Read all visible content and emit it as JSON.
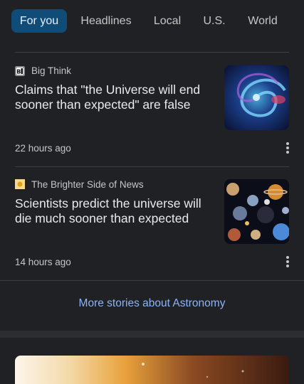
{
  "tabs": [
    {
      "label": "For you",
      "active": true
    },
    {
      "label": "Headlines",
      "active": false
    },
    {
      "label": "Local",
      "active": false
    },
    {
      "label": "U.S.",
      "active": false
    },
    {
      "label": "World",
      "active": false
    }
  ],
  "articles": [
    {
      "source": "Big Think",
      "source_icon": "big-think-logo",
      "headline": "Claims that \"the Universe will end sooner than expected\" are false",
      "time": "22 hours ago",
      "thumbnail": "spiral-galaxy-image"
    },
    {
      "source": "The Brighter Side of News",
      "source_icon": "brighter-side-logo",
      "headline": "Scientists predict the universe will die much sooner than expected",
      "time": "14 hours ago",
      "thumbnail": "planets-collage-image"
    }
  ],
  "more_stories": "More stories about Astronomy",
  "colors": {
    "background": "#202124",
    "tab_active_bg": "#104c78",
    "link": "#8ab4f8",
    "text_primary": "#e8eaed",
    "text_secondary": "#c4c7c5"
  }
}
